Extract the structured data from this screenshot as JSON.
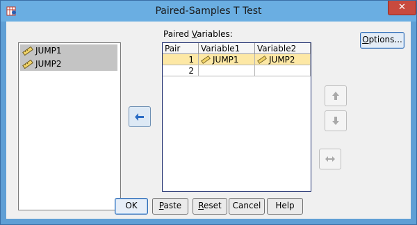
{
  "window": {
    "title": "Paired-Samples T Test",
    "close_label": "✕"
  },
  "source_list": {
    "items": [
      {
        "label": "JUMP1",
        "icon": "ruler-icon"
      },
      {
        "label": "JUMP2",
        "icon": "ruler-icon"
      }
    ]
  },
  "paired": {
    "label_before": "Paired ",
    "label_underlined": "V",
    "label_after": "ariables:",
    "columns": [
      "Pair",
      "Variable1",
      "Variable2"
    ],
    "rows": [
      {
        "pair": "1",
        "var1": "JUMP1",
        "var2": "JUMP2",
        "selected": true
      },
      {
        "pair": "2",
        "var1": "",
        "var2": "",
        "selected": false
      }
    ]
  },
  "options": {
    "pre": "",
    "underlined": "O",
    "post": "ptions..."
  },
  "buttons": {
    "ok": "OK",
    "paste": {
      "underlined": "P",
      "rest": "aste"
    },
    "reset": {
      "underlined": "R",
      "rest": "eset"
    },
    "cancel": "Cancel",
    "help": "Help"
  },
  "colors": {
    "accent": "#2f6bb5",
    "selection": "#fde8a5",
    "titlebar": "#6aaee2",
    "close": "#c84a3e"
  }
}
